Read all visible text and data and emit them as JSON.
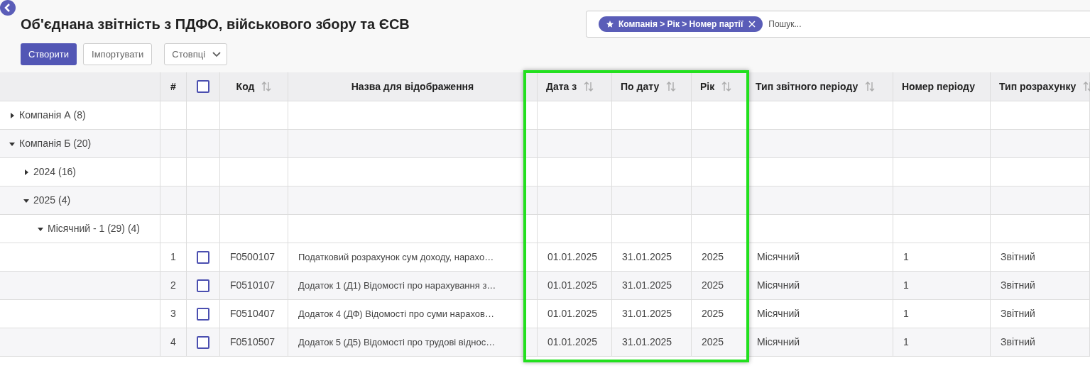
{
  "page": {
    "title": "Об'єднана звітність з ПДФО, військового збору та ЄСВ"
  },
  "buttons": [
    {
      "label": "Створити",
      "kind": "primary"
    },
    {
      "label": "Імпортувати",
      "kind": "secondary"
    },
    {
      "label": "Стовпці",
      "kind": "dropdown"
    }
  ],
  "search": {
    "facet": "Компанія > Рік > Номер партії",
    "placeholder": "Пошук..."
  },
  "table": {
    "columns": [
      {
        "label": "#",
        "sortable": false
      },
      {
        "kind": "checkbox",
        "checked": false
      },
      {
        "label": "Код",
        "sortable": true
      },
      {
        "label": "Назва для відображення",
        "sortable": false
      },
      {
        "label": "Дата з",
        "sortable": true
      },
      {
        "label": "По дату",
        "sortable": true
      },
      {
        "label": "Рік",
        "sortable": true
      },
      {
        "label": "Тип звітного періоду",
        "sortable": true
      },
      {
        "label": "Номер періоду",
        "sortable": false
      },
      {
        "label": "Тип розрахунку",
        "sortable": true
      }
    ],
    "groups": [
      {
        "label": "Компанія А (8)",
        "expanded": false
      },
      {
        "label": "Компанія Б (20)",
        "expanded": true,
        "children": [
          {
            "label": "2024 (16)",
            "expanded": false
          },
          {
            "label": "2025 (4)",
            "expanded": true,
            "children": [
              {
                "label": "Місячний - 1 (29) (4)",
                "expanded": true,
                "records": [
                  {
                    "number": "1",
                    "checked": false,
                    "code": "F0500107",
                    "name": "Податковий розрахунок сум доходу, нарахо…",
                    "date_from": "01.01.2025",
                    "date_to": "31.01.2025",
                    "year": "2025",
                    "period_type": "Місячний",
                    "period_number": "1",
                    "calc_type": "Звітний"
                  },
                  {
                    "number": "2",
                    "checked": false,
                    "code": "F0510107",
                    "name": "Додаток 1 (Д1) Відомості про нарахування з…",
                    "date_from": "01.01.2025",
                    "date_to": "31.01.2025",
                    "year": "2025",
                    "period_type": "Місячний",
                    "period_number": "1",
                    "calc_type": "Звітний"
                  },
                  {
                    "number": "3",
                    "checked": false,
                    "code": "F0510407",
                    "name": "Додаток 4 (ДФ) Відомості про суми нарахов…",
                    "date_from": "01.01.2025",
                    "date_to": "31.01.2025",
                    "year": "2025",
                    "period_type": "Місячний",
                    "period_number": "1",
                    "calc_type": "Звітний"
                  },
                  {
                    "number": "4",
                    "checked": false,
                    "code": "F0510507",
                    "name": "Додаток 5 (Д5) Відомості про трудові віднос…",
                    "date_from": "01.01.2025",
                    "date_to": "31.01.2025",
                    "year": "2025",
                    "period_type": "Місячний",
                    "period_number": "1",
                    "calc_type": "Звітний"
                  }
                ]
              }
            ]
          }
        ]
      }
    ]
  },
  "highlight": {
    "color": "#22e01e"
  }
}
